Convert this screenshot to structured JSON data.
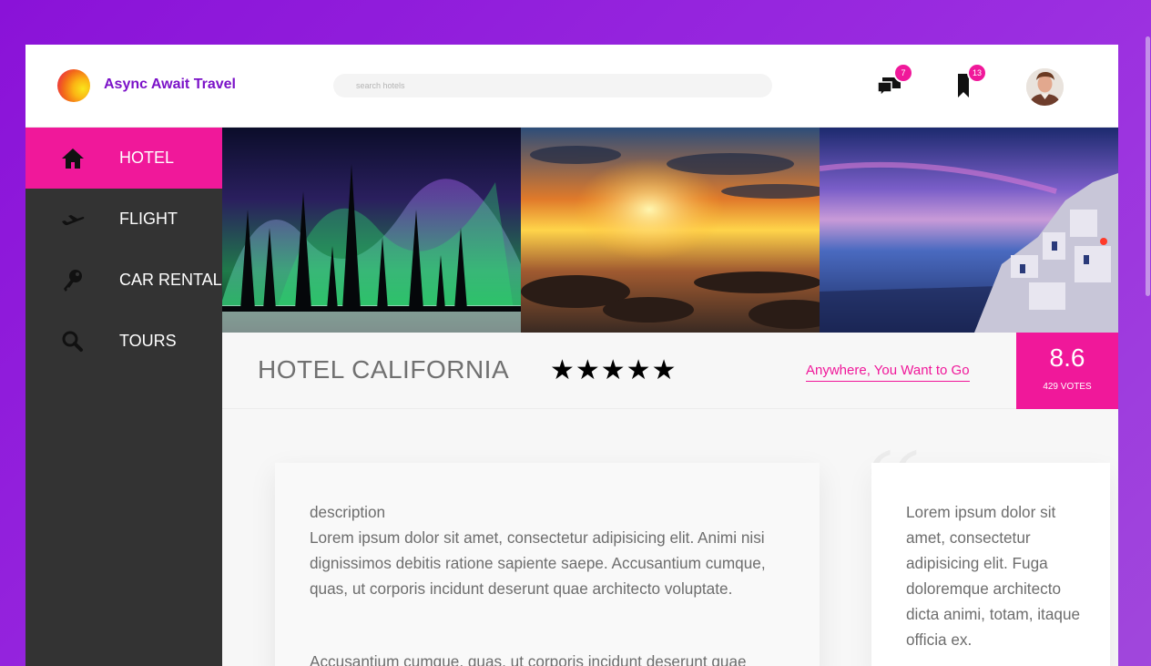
{
  "app": {
    "brand": "Async Await Travel"
  },
  "header": {
    "search_placeholder": "search hotels",
    "messages_count": "7",
    "bookmarks_count": "13"
  },
  "sidebar": {
    "items": [
      {
        "label": "HOTEL",
        "icon": "home-icon",
        "active": true
      },
      {
        "label": "FLIGHT",
        "icon": "airplane-icon",
        "active": false
      },
      {
        "label": "CAR RENTAL",
        "icon": "key-icon",
        "active": false
      },
      {
        "label": "TOURS",
        "icon": "search-icon",
        "active": false
      }
    ]
  },
  "gallery": {
    "photos": [
      "northern-lights-photo",
      "beach-sunset-photo",
      "santorini-photo"
    ]
  },
  "hotel": {
    "name": "HOTEL CALIFORNIA",
    "stars": "★★★★★",
    "tagline": "Anywhere, You Want to Go",
    "rating_score": "8.6",
    "rating_votes": "429 VOTES"
  },
  "description": {
    "heading": "description",
    "paragraph1": "Lorem ipsum dolor sit amet, consectetur adipisicing elit. Animi nisi dignissimos debitis ratione sapiente saepe. Accusantium cumque, quas, ut corporis incidunt deserunt quae architecto voluptate.",
    "paragraph2": "Accusantium cumque, quas, ut corporis incidunt deserunt quae"
  },
  "quote": {
    "mark": "“",
    "text": "Lorem ipsum dolor sit amet, consectetur adipisicing elit. Fuga doloremque architecto dicta animi, totam, itaque officia ex."
  },
  "colors": {
    "accent": "#f0189a",
    "brand": "#7b12c8",
    "sidebar": "#333333",
    "background": "#9b2ee0"
  }
}
